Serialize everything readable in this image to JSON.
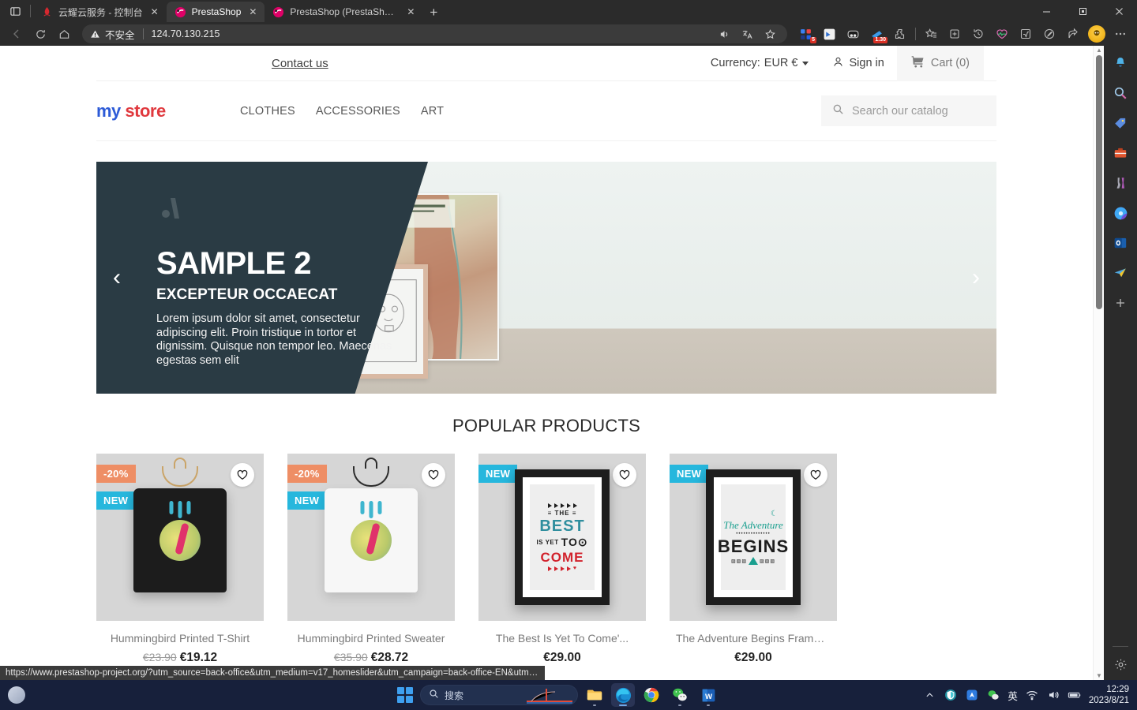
{
  "browser": {
    "tabs": [
      {
        "title": "云耀云服务 - 控制台",
        "favicon": "huawei-icon",
        "active": false
      },
      {
        "title": "PrestaShop",
        "favicon": "prestashop-icon",
        "active": true
      },
      {
        "title": "PrestaShop (PrestaShop™)",
        "favicon": "prestashop-icon",
        "active": false
      }
    ],
    "new_tab_label": "+",
    "window_controls": {
      "minimize": "—",
      "maximize": "▢",
      "close": "✕"
    },
    "address_bar": {
      "security_label": "不安全",
      "url": "124.70.130.215"
    },
    "toolbar_icons": [
      "read-aloud-icon",
      "translate-icon",
      "favorite-star-icon",
      "extension-puzzle-icon",
      "collections-icon",
      "history-icon",
      "performance-icon",
      "math-solver-icon",
      "screenshot-icon",
      "share-icon",
      "profile-avatar-icon",
      "settings-more-icon"
    ],
    "extension_badges": [
      "5",
      "1.30"
    ],
    "status_url": "https://www.prestashop-project.org/?utm_source=back-office&utm_medium=v17_homeslider&utm_campaign=back-office-EN&utm_content=download"
  },
  "sidebar": {
    "items": [
      {
        "name": "notifications-bell-icon"
      },
      {
        "name": "search-icon"
      },
      {
        "name": "shopping-tag-icon"
      },
      {
        "name": "briefcase-icon"
      },
      {
        "name": "games-icon"
      },
      {
        "name": "copilot-icon"
      },
      {
        "name": "outlook-icon"
      },
      {
        "name": "send-paper-plane-icon"
      },
      {
        "name": "add-sidebar-icon"
      }
    ],
    "settings_label": "gear-icon"
  },
  "shop": {
    "topbar": {
      "contact_us": "Contact us",
      "currency_label": "Currency:",
      "currency_value": "EUR €",
      "sign_in": "Sign in",
      "cart": "Cart (0)"
    },
    "logo": {
      "part1": "my",
      "part2": "store"
    },
    "menu": [
      {
        "label": "CLOTHES"
      },
      {
        "label": "ACCESSORIES"
      },
      {
        "label": "ART"
      }
    ],
    "search": {
      "placeholder": "Search our catalog",
      "value": ""
    },
    "carousel": {
      "title": "SAMPLE 2",
      "subtitle": "EXCEPTEUR OCCAECAT",
      "body": "Lorem ipsum dolor sit amet, consectetur adipiscing elit. Proin tristique in tortor et dignissim. Quisque non tempor leo. Maecenas egestas sem elit",
      "prev": "‹",
      "next": "›"
    },
    "popular_title": "POPULAR PRODUCTS",
    "products": [
      {
        "name": "Hummingbird Printed T-Shirt",
        "price": "€19.12",
        "old_price": "€23.90",
        "discount_flag": "-20%",
        "new_flag": "NEW",
        "art": "tshirt-black"
      },
      {
        "name": "Hummingbird Printed Sweater",
        "price": "€28.72",
        "old_price": "€35.90",
        "discount_flag": "-20%",
        "new_flag": "NEW",
        "art": "sweater-white"
      },
      {
        "name": "The Best Is Yet To Come'...",
        "price": "€29.00",
        "old_price": "",
        "discount_flag": "",
        "new_flag": "NEW",
        "art": "poster-best"
      },
      {
        "name": "The Adventure Begins Framed...",
        "price": "€29.00",
        "old_price": "",
        "discount_flag": "",
        "new_flag": "NEW",
        "art": "poster-adventure"
      }
    ]
  },
  "taskbar": {
    "search_placeholder": "搜索",
    "apps": [
      {
        "name": "file-explorer-icon"
      },
      {
        "name": "microsoft-edge-icon"
      },
      {
        "name": "google-chrome-icon"
      },
      {
        "name": "wechat-icon"
      },
      {
        "name": "microsoft-word-icon"
      }
    ],
    "tray": [
      {
        "name": "show-hidden-icons-chevron"
      },
      {
        "name": "security-shield-icon"
      },
      {
        "name": "blue-app-icon"
      },
      {
        "name": "wechat-tray-icon"
      },
      {
        "name": "ime-language-icon",
        "label": "英"
      },
      {
        "name": "wifi-icon"
      },
      {
        "name": "volume-icon"
      },
      {
        "name": "battery-icon"
      }
    ],
    "clock_time": "12:29",
    "clock_date": "2023/8/21"
  },
  "colors": {
    "accent_blue": "#26b7dd",
    "discount_orange": "#ee8e65",
    "carousel_dark": "#2a3b44",
    "taskbar": "#17203b"
  }
}
